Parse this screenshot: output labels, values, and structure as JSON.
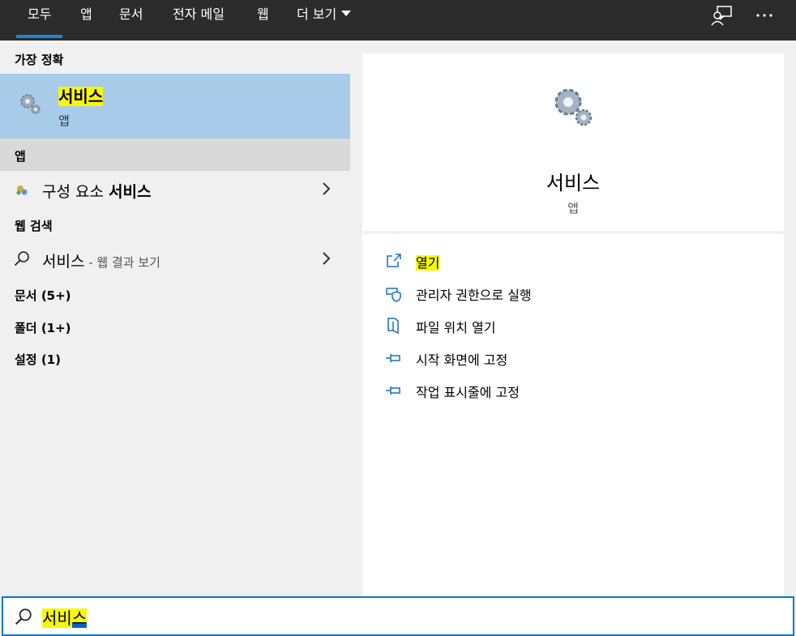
{
  "tabs": [
    {
      "label": "모두",
      "active": true
    },
    {
      "label": "앱"
    },
    {
      "label": "문서"
    },
    {
      "label": "전자 메일"
    },
    {
      "label": "웹"
    },
    {
      "label": "더 보기"
    }
  ],
  "top_icons": [
    "feedback-icon",
    "more-options-icon"
  ],
  "left": {
    "best_match_header": "가장 정확",
    "best_match": {
      "title": "서비스",
      "subtitle": "앱",
      "icon": "gears-icon"
    },
    "apps_header": "앱",
    "apps": [
      {
        "prefix": "구성 요소 ",
        "bold": "서비스",
        "icon": "component-services-icon"
      }
    ],
    "web_header": "웹 검색",
    "web": {
      "query": "서비스",
      "suffix": " - 웹 결과 보기"
    },
    "categories": [
      "문서 (5+)",
      "폴더 (1+)",
      "설정 (1)"
    ]
  },
  "right": {
    "title": "서비스",
    "subtitle": "앱",
    "actions": [
      {
        "label": "열기",
        "icon": "open-icon"
      },
      {
        "label": "관리자 권한으로 실행",
        "icon": "shield-icon"
      },
      {
        "label": "파일 위치 열기",
        "icon": "file-location-icon"
      },
      {
        "label": "시작 화면에 고정",
        "icon": "pin-icon"
      },
      {
        "label": "작업 표시줄에 고정",
        "icon": "pin-icon"
      }
    ]
  },
  "search": {
    "value_main": "서비",
    "value_selected": "스"
  },
  "colors": {
    "accent": "#0078d7",
    "highlight": "#f7f70c",
    "selected_bg": "#a8cbe9",
    "topbar": "#2b2b2b"
  }
}
